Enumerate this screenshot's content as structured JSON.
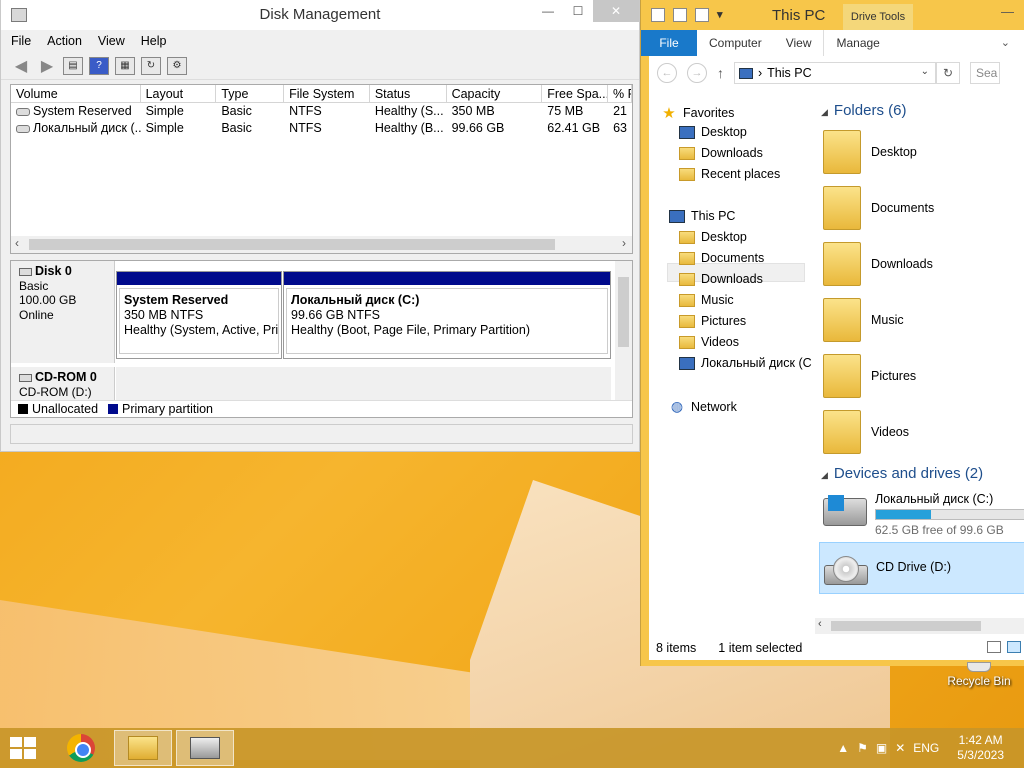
{
  "disk_management": {
    "title": "Disk Management",
    "menu": [
      "File",
      "Action",
      "View",
      "Help"
    ],
    "columns": [
      "Volume",
      "Layout",
      "Type",
      "File System",
      "Status",
      "Capacity",
      "Free Spa...",
      "% F"
    ],
    "volumes": [
      {
        "volume": "System Reserved",
        "layout": "Simple",
        "type": "Basic",
        "fs": "NTFS",
        "status": "Healthy (S...",
        "capacity": "350 MB",
        "free": "75 MB",
        "pct": "21"
      },
      {
        "volume": "Локальный диск (...",
        "layout": "Simple",
        "type": "Basic",
        "fs": "NTFS",
        "status": "Healthy (B...",
        "capacity": "99.66 GB",
        "free": "62.41 GB",
        "pct": "63"
      }
    ],
    "disk0": {
      "name": "Disk 0",
      "kind": "Basic",
      "size": "100.00 GB",
      "state": "Online"
    },
    "partitions": [
      {
        "name": "System Reserved",
        "size": "350 MB NTFS",
        "status": "Healthy (System, Active, Prin"
      },
      {
        "name": "Локальный диск  (C:)",
        "size": "99.66 GB NTFS",
        "status": "Healthy (Boot, Page File, Primary Partition)"
      }
    ],
    "cdrom": {
      "name": "CD-ROM 0",
      "drive": "CD-ROM (D:)"
    },
    "legend": {
      "unallocated": "Unallocated",
      "primary": "Primary partition",
      "unallocated_color": "#000000",
      "primary_color": "#000a8c"
    }
  },
  "explorer": {
    "title": "This PC",
    "context_tab": "Drive Tools",
    "ribbon_tabs": [
      "File",
      "Computer",
      "View",
      "Manage"
    ],
    "address": "This PC",
    "search_placeholder": "Sea",
    "nav": {
      "favorites": "Favorites",
      "fav_items": [
        "Desktop",
        "Downloads",
        "Recent places"
      ],
      "this_pc": "This PC",
      "pc_items": [
        "Desktop",
        "Documents",
        "Downloads",
        "Music",
        "Pictures",
        "Videos",
        "Локальный диск (C"
      ],
      "network": "Network"
    },
    "folders_header": "Folders (6)",
    "folders": [
      "Desktop",
      "Documents",
      "Downloads",
      "Music",
      "Pictures",
      "Videos"
    ],
    "devices_header": "Devices and drives (2)",
    "drives": [
      {
        "name": "Локальный диск (C:)",
        "free": "62.5 GB free of 99.6 GB",
        "used_fraction": 0.37
      },
      {
        "name": "CD Drive (D:)"
      }
    ],
    "status": {
      "items": "8 items",
      "selected": "1 item selected"
    }
  },
  "desktop": {
    "recycle_bin": "Recycle Bin"
  },
  "taskbar": {
    "lang": "ENG",
    "time": "1:42 AM",
    "date": "5/3/2023"
  }
}
